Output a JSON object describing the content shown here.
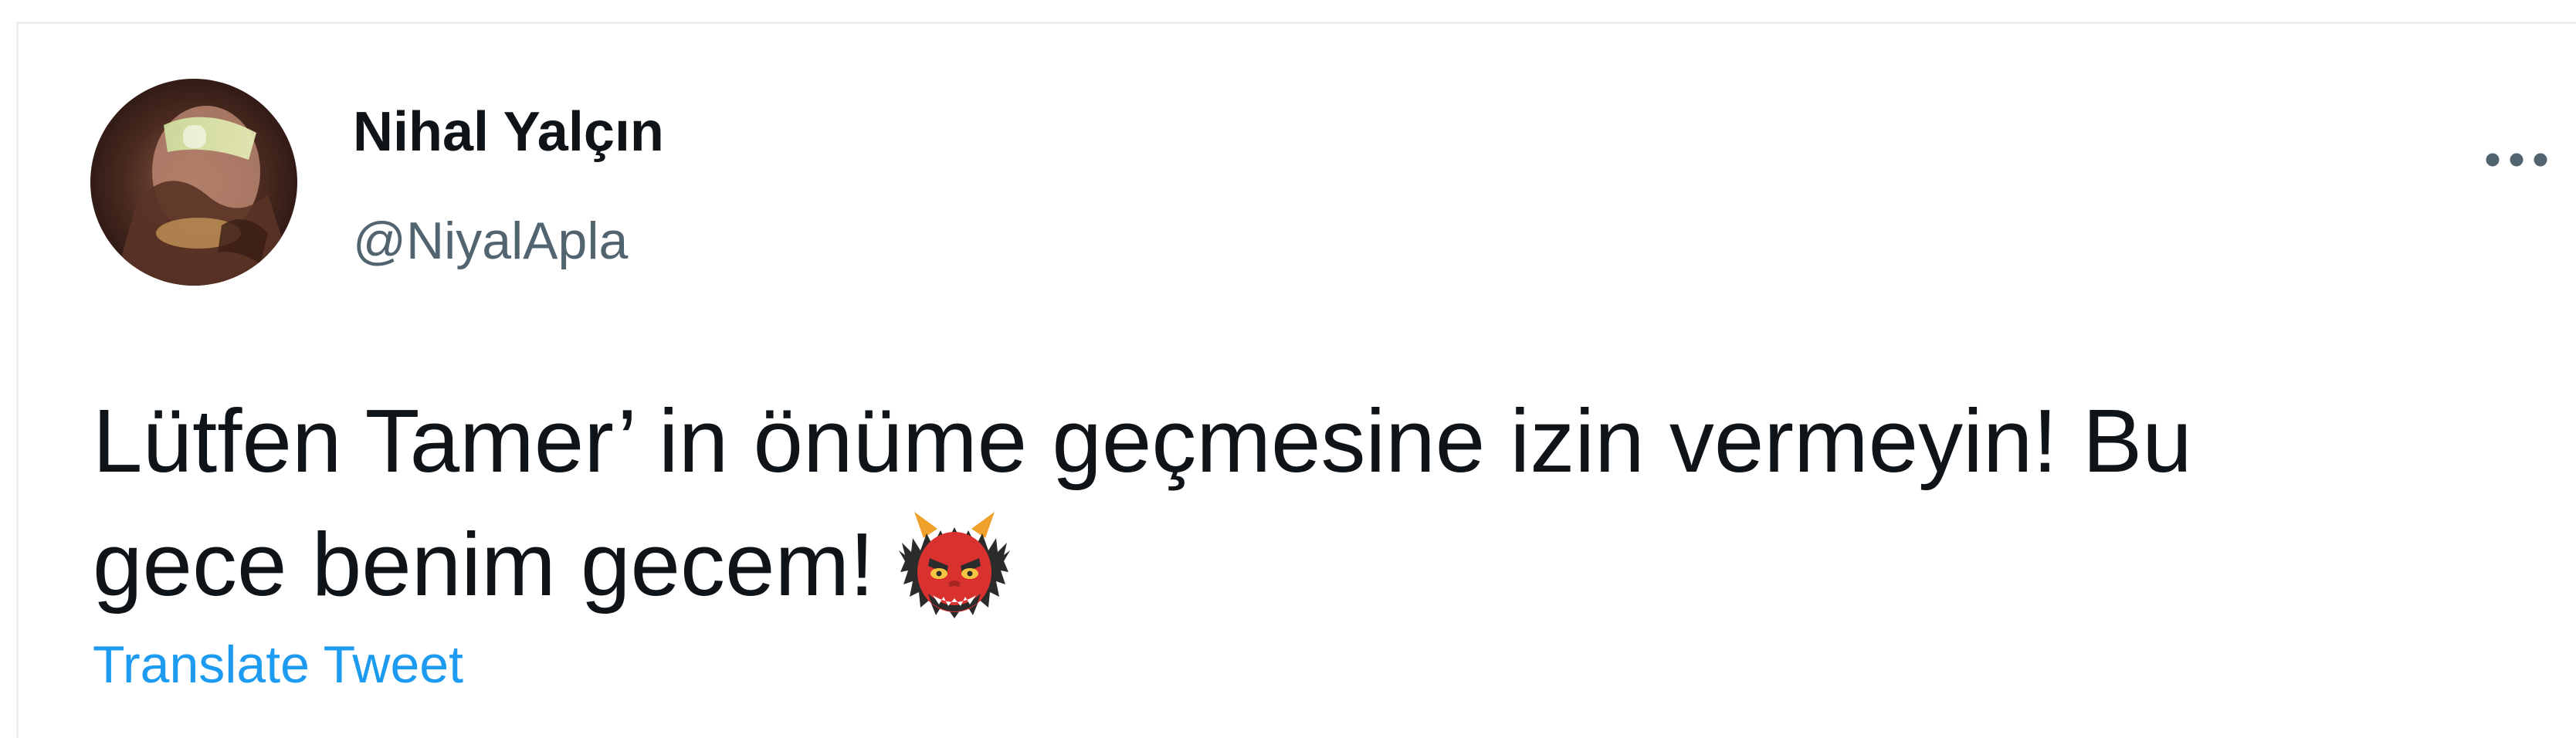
{
  "tweet": {
    "author": {
      "display_name": "Nihal Yalçın",
      "handle": "@NiyalApla",
      "avatar": "profile-photo"
    },
    "more_icon": "more-horizontal-icon",
    "text_lines": [
      "Lütfen Tamer’ in önüme geçmesine izin vermeyin! Bu",
      "gece benim gecem!"
    ],
    "emoji": "ogre-icon",
    "translate_label": "Translate Tweet"
  },
  "colors": {
    "text_primary": "#0f1419",
    "text_secondary": "#536471",
    "link": "#1d9bf0",
    "border": "#eceef0"
  }
}
